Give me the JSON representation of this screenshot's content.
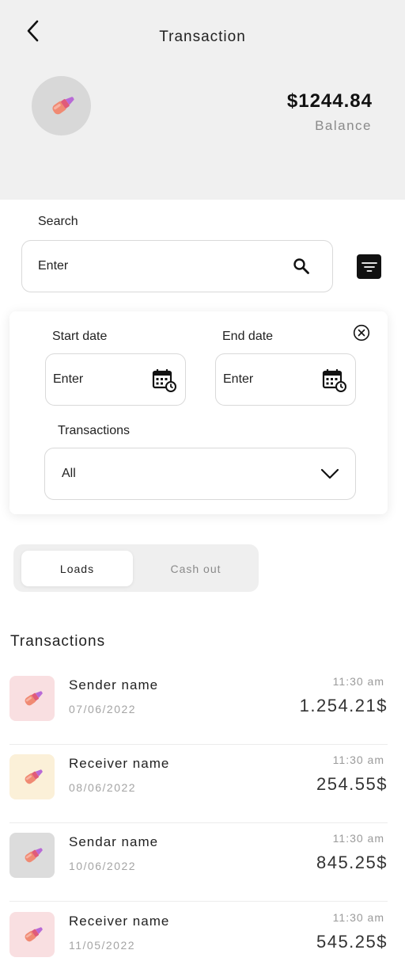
{
  "header": {
    "title": "Transaction",
    "balance_amount": "$1244.84",
    "balance_label": "Balance",
    "icons": {
      "back": "chevron-left-icon",
      "avatar": "lipstick-icon"
    }
  },
  "search": {
    "label": "Search",
    "placeholder": "Enter",
    "icons": {
      "search": "search-icon",
      "filter": "filter-icon"
    }
  },
  "filters": {
    "start_date_label": "Start date",
    "start_date_placeholder": "Enter",
    "end_date_label": "End date",
    "end_date_placeholder": "Enter",
    "transactions_label": "Transactions",
    "transactions_selected": "All",
    "icons": {
      "close": "close-circle-icon",
      "calendar": "calendar-clock-icon",
      "dropdown": "chevron-down-icon"
    }
  },
  "tabs": [
    {
      "label": "Loads",
      "active": true
    },
    {
      "label": "Cash out",
      "active": false
    }
  ],
  "transactions": {
    "title": "Transactions",
    "items": [
      {
        "name": "Sender name",
        "date": "07/06/2022",
        "time": "11:30 am",
        "amount": "1.254.21$",
        "bg": "#f9dfe1"
      },
      {
        "name": "Receiver name",
        "date": "08/06/2022",
        "time": "11:30 am",
        "amount": "254.55$",
        "bg": "#fbf0d8"
      },
      {
        "name": "Sendar name",
        "date": "10/06/2022",
        "time": "11:30 am",
        "amount": "845.25$",
        "bg": "#dcdcdc"
      },
      {
        "name": "Receiver name",
        "date": "11/05/2022",
        "time": "11:30 am",
        "amount": "545.25$",
        "bg": "#f9dfe1"
      }
    ]
  },
  "colors": {
    "header_bg": "#f0f0f0",
    "accent": "#111111",
    "muted": "#8a8a8a"
  }
}
